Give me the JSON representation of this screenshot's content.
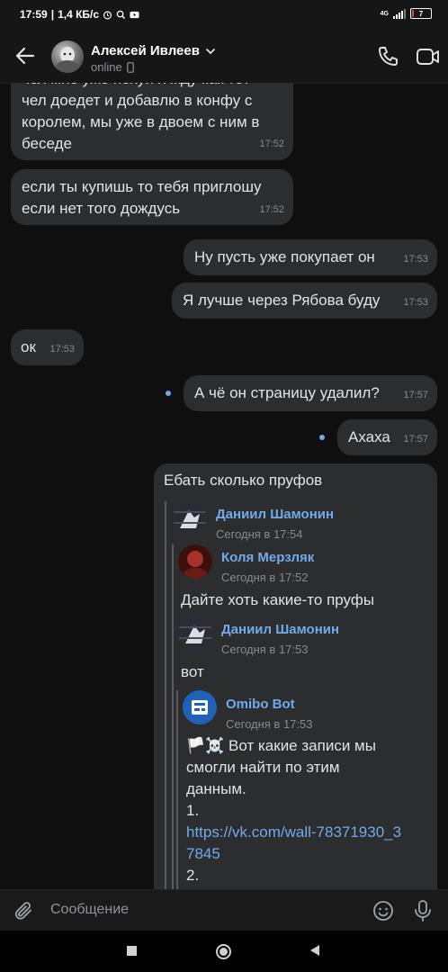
{
  "status_bar": {
    "time": "17:59",
    "speed": "1,4 КБ/с",
    "network": "4G",
    "battery": "7",
    "battery_level_percent": 7
  },
  "header": {
    "contact_name": "Алексей Ивлеев",
    "status": "online"
  },
  "messages": [
    {
      "side": "in",
      "text_lines": [
        "чел мне уже похуй я жду как тот",
        "чел доедет и добавлю в конфу с",
        "королем, мы уже в двоем с ним в",
        "беседе"
      ],
      "time": "17:52"
    },
    {
      "side": "in",
      "text_lines": [
        "если ты купишь то тебя приглошу",
        "если нет того дождусь"
      ],
      "time": "17:52"
    },
    {
      "side": "out",
      "text": "Ну пусть уже покупает он",
      "time": "17:53"
    },
    {
      "side": "out",
      "text": "Я лучше через Рябова буду",
      "time": "17:53"
    },
    {
      "side": "in",
      "text": "ок",
      "time": "17:53"
    },
    {
      "side": "out",
      "text": "А чё он страницу удалил?",
      "time": "17:57",
      "unread": true
    },
    {
      "side": "out",
      "text": "Ахаха",
      "time": "17:57",
      "unread": true
    }
  ],
  "forwarded_message": {
    "text": "Ебать сколько пруфов",
    "fwd1": {
      "author": "Даниил Шамонин",
      "date": "Сегодня в 17:54"
    },
    "fwd2": {
      "author": "Коля Мерзляк",
      "date": "Сегодня в 17:52",
      "text": "Дайте хоть какие-то пруфы"
    },
    "fwd3": {
      "author": "Даниил Шамонин",
      "date": "Сегодня в 17:53",
      "text": "вот"
    },
    "fwd4": {
      "author": "Omibo Bot",
      "date": "Сегодня в 17:53",
      "text_lines": [
        "🏳️☠️ Вот какие записи мы",
        "смогли найти по этим",
        "данным."
      ],
      "item1": "1.",
      "link_lines": [
        "https://vk.com/wall-78371930_3",
        "7845"
      ],
      "item2": "2."
    }
  },
  "composer": {
    "placeholder": "Сообщение"
  },
  "icons": {
    "back": "arrow-left-icon",
    "call": "phone-icon",
    "video": "video-camera-icon",
    "attach": "paperclip-icon",
    "emoji": "smile-icon",
    "mic": "microphone-icon"
  },
  "colors": {
    "accent": "#71aaeb",
    "bubble": "#2c2d2e",
    "background": "#0f0f10"
  }
}
